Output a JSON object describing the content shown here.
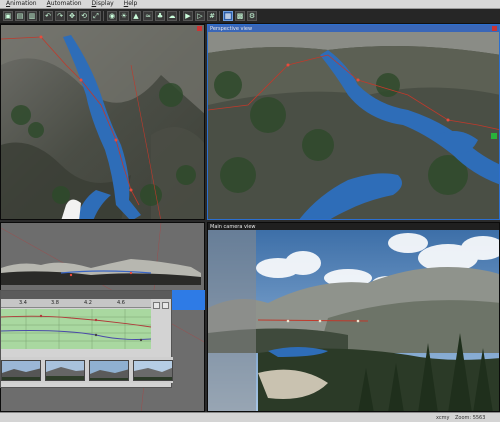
{
  "menu": {
    "items": [
      "Animation",
      "Automation",
      "Display",
      "Help"
    ]
  },
  "toolbar": {
    "buttons": [
      {
        "icon": "new-scene-icon",
        "glyph": "▣"
      },
      {
        "icon": "open-icon",
        "glyph": "▤"
      },
      {
        "icon": "save-icon",
        "glyph": "▥"
      },
      {
        "icon": "undo-icon",
        "glyph": "↶"
      },
      {
        "icon": "redo-icon",
        "glyph": "↷"
      },
      {
        "icon": "move-icon",
        "glyph": "✥"
      },
      {
        "icon": "rotate-icon",
        "glyph": "⟲"
      },
      {
        "icon": "scale-icon",
        "glyph": "⤢"
      },
      {
        "icon": "camera-icon",
        "glyph": "◉"
      },
      {
        "icon": "light-icon",
        "glyph": "☀"
      },
      {
        "icon": "terrain-icon",
        "glyph": "▲"
      },
      {
        "icon": "water-icon",
        "glyph": "≈"
      },
      {
        "icon": "tree-icon",
        "glyph": "♣"
      },
      {
        "icon": "cloud-icon",
        "glyph": "☁"
      },
      {
        "icon": "render-icon",
        "glyph": "▶"
      },
      {
        "icon": "preview-icon",
        "glyph": "▷"
      },
      {
        "icon": "grid-icon",
        "glyph": "#"
      },
      {
        "icon": "view-mode-icon",
        "glyph": "▦"
      },
      {
        "icon": "layout-icon",
        "glyph": "▩"
      },
      {
        "icon": "settings-icon",
        "glyph": "⚙"
      }
    ]
  },
  "viewports": {
    "top_left": {
      "title": "",
      "corner": ""
    },
    "top_right": {
      "title": "Perspective view",
      "corner": ""
    },
    "bottom_left": {
      "title": "",
      "corner": ""
    },
    "bottom_right": {
      "title": "Main camera view",
      "corner": ""
    }
  },
  "timeline": {
    "ticks": [
      "3.4",
      "3.8",
      "4.2",
      "4.6"
    ]
  },
  "status": {
    "left": "",
    "right_a": "xcmy",
    "right_b": "Zoom: 5563"
  },
  "colors": {
    "accent": "#2e7be6",
    "path_line": "#c0392b",
    "water": "#2e6db8"
  }
}
